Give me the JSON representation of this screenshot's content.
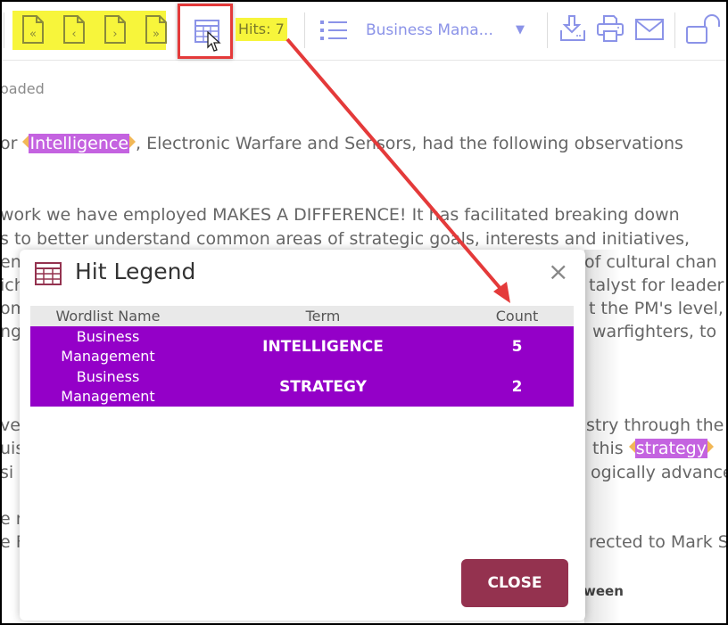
{
  "toolbar": {
    "nav_buttons": [
      {
        "name": "first-page",
        "glyph": "«"
      },
      {
        "name": "previous-page",
        "glyph": "‹"
      },
      {
        "name": "next-page",
        "glyph": "›"
      },
      {
        "name": "last-page",
        "glyph": "»"
      }
    ],
    "hits_label": "Hits: 7",
    "wordlist_selected": "Business Mana...",
    "caret": "▼",
    "icons": [
      "hit-legend-grid-icon",
      "list-icon",
      "download-icon",
      "print-icon",
      "email-icon",
      "unlock-icon"
    ],
    "highlight_color": "#f7f53b"
  },
  "document": {
    "loaded_text": "oaded",
    "line1_pre": "or ",
    "line1_hit": "Intelligence",
    "line1_post": ", Electronic Warfare and Sensors, had the following observations",
    "line2": "work we have employed MAKES A DIFFERENCE! It has facilitated breaking down",
    "line3": "s to better understand common areas of strategic goals, interests and initiatives,",
    "line4_left": "en",
    "line4_right": "of cultural chan",
    "line5_left": "ich",
    "line5_right": "talyst for leader",
    "line6_left": "om",
    "line6_right": "t the PM's level,",
    "line7_left": "ng",
    "line7_right": "warfighters, to",
    "line8_left": "ve",
    "line8_right": "stry through the",
    "line9_left": "uis",
    "line9_pre": "this ",
    "line9_hit": "strategy",
    "line10_left": "si",
    "line10_right": "ogically advance",
    "line11_left": "e r",
    "line12_left": "e F",
    "line12_right": "rected to Mark S",
    "line13_right": "ween",
    "hit_color": "#c463e0"
  },
  "modal": {
    "title": "Hit Legend",
    "close_icon": "×",
    "columns": [
      "Wordlist Name",
      "Term",
      "Count"
    ],
    "rows": [
      {
        "wordlist_line1": "Business",
        "wordlist_line2": "Management",
        "term": "INTELLIGENCE",
        "count": "5"
      },
      {
        "wordlist_line1": "Business",
        "wordlist_line2": "Management",
        "term": "STRATEGY",
        "count": "2"
      }
    ],
    "row_color": "#9400c8",
    "close_button": "CLOSE",
    "close_button_color": "#94324f"
  },
  "annotation": {
    "highlight_box_color": "#e43a3a",
    "arrow_color": "#e43a3a"
  }
}
